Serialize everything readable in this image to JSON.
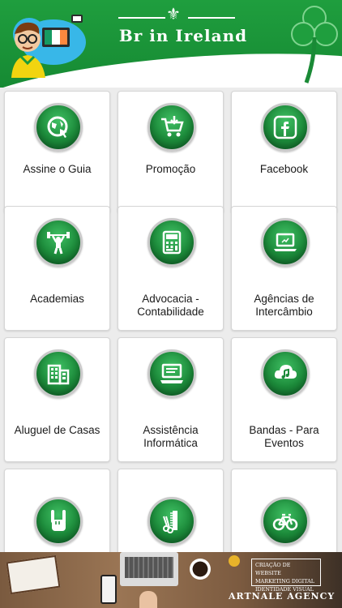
{
  "header": {
    "title": "Br in Ireland",
    "brand_green": "#1a9a3c",
    "accent_orange": "#f39a1f"
  },
  "grid": {
    "items": [
      {
        "label": "Assine o Guia",
        "icon": "globe-cursor-icon"
      },
      {
        "label": "Promoção",
        "icon": "shopping-cart-icon"
      },
      {
        "label": "Facebook",
        "icon": "facebook-icon"
      },
      {
        "label": "Academias",
        "icon": "weightlifter-icon"
      },
      {
        "label": "Advocacia - Contabilidade",
        "icon": "calculator-icon"
      },
      {
        "label": "Agências de Intercâmbio",
        "icon": "laptop-icon"
      },
      {
        "label": "Aluguel de Casas",
        "icon": "building-icon"
      },
      {
        "label": "Assistência Informática",
        "icon": "computer-icon"
      },
      {
        "label": "Bandas - Para Eventos",
        "icon": "cloud-music-icon"
      },
      {
        "label": "",
        "icon": "rock-hand-icon"
      },
      {
        "label": "",
        "icon": "comb-scissors-icon"
      },
      {
        "label": "",
        "icon": "bicycle-icon"
      }
    ]
  },
  "ad": {
    "lines": [
      "CRIAÇÃO DE WEBSITE",
      "MARKETING DIGITAL",
      "IDENTIDADE VISUAL"
    ],
    "agency": "ARTNALE AGENCY"
  }
}
